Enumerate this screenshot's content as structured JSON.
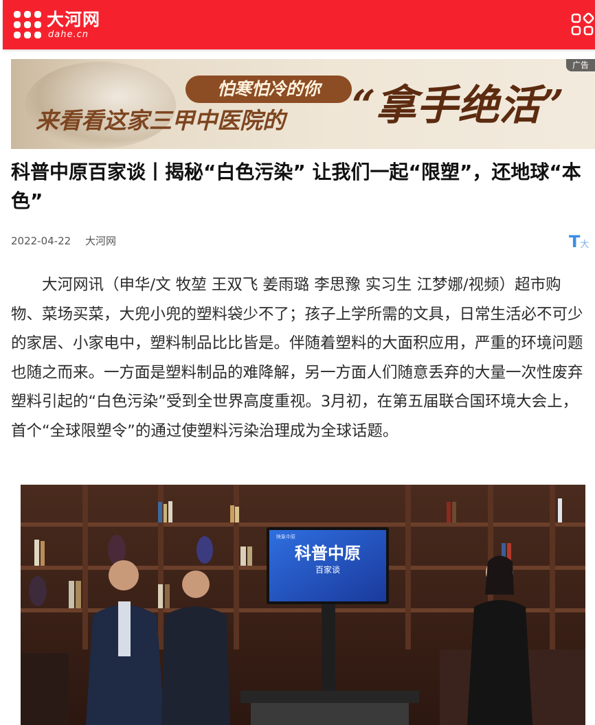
{
  "header": {
    "logo_text": "大河网",
    "logo_sub": "dahe.cn",
    "brand_color": "#f5222d",
    "menu_icon": "grid-menu-icon"
  },
  "ad": {
    "tagline": "怕寒怕冷的你",
    "line2": "来看看这家三甲中医院的",
    "headline": "“拿手绝活”",
    "tag": "广告"
  },
  "article": {
    "title": "科普中原百家谈丨揭秘“白色污染” 让我们一起“限塑”，还地球“本色”",
    "date": "2022-04-22",
    "source": "大河网",
    "font_tool": {
      "big": "T",
      "small": "大"
    },
    "paragraph": "大河网讯（申华/文 牧堃 王双飞 姜雨璐 李思豫 实习生 江梦娜/视频）超市购物、菜场买菜，大兜小兜的塑料袋少不了；孩子上学所需的文具，日常生活必不可少的家居、小家电中，塑料制品比比皆是。伴随着塑料的大面积应用，严重的环境问题也随之而来。一方面是塑料制品的难降解，另一方面人们随意丢弃的大量一次性废弃塑料引起的“白色污染”受到全世界高度重视。3月初，在第五届联合国环境大会上，首个“全球限塑令”的通过使塑料污染治理成为全球话题。"
  },
  "photo": {
    "screen_title": "科普中原",
    "screen_subtitle": "百家谈",
    "screen_logo": "映象中原"
  }
}
